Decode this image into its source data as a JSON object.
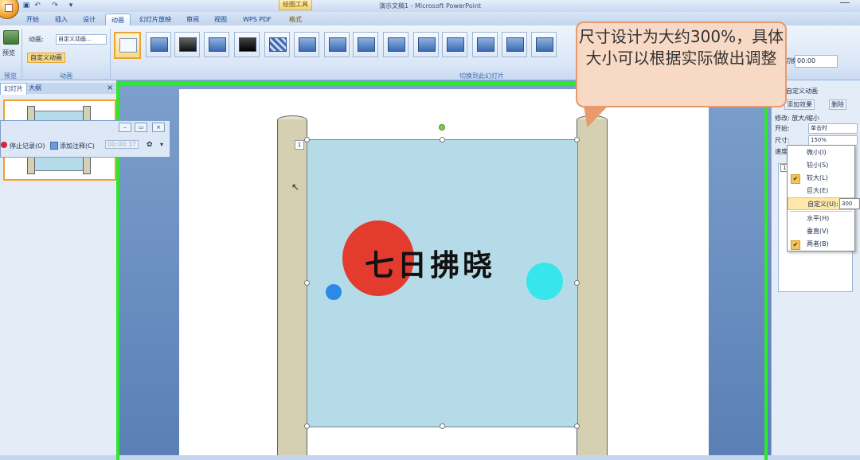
{
  "window": {
    "title": "演示文稿1 - Microsoft PowerPoint",
    "contextual_tab": "绘图工具"
  },
  "tabs": [
    "开始",
    "插入",
    "设计",
    "动画",
    "幻灯片放映",
    "审阅",
    "视图",
    "WPS PDF",
    "格式"
  ],
  "active_tab": "动画",
  "ribbon": {
    "preview_label": "预览",
    "preview_group": "预览",
    "animation_label": "动画:",
    "animation_select": "自定义动画...",
    "custom_animation_button": "自定义动画",
    "animation_group": "动画",
    "transition_group": "切换到此幻灯片",
    "speed_label": "切换效果:",
    "speed_value": "00:00"
  },
  "left_pane": {
    "tabs": [
      "幻灯片",
      "大纲"
    ],
    "stop_record": "停止记录(O)",
    "add_note": "添加注释(C)",
    "timer": "00:00:37"
  },
  "slide": {
    "title": "七日拂晓",
    "order_tag": "1"
  },
  "callout": {
    "text": "尺寸设计为大约300%，具体大小可以根据实际做出调整"
  },
  "task_pane": {
    "header": "自定义动画",
    "add_effect": "添加效果",
    "remove_button": "删除",
    "modify_label": "修改: 放大/缩小",
    "start_label": "开始:",
    "start_value": "单击时",
    "size_label": "尺寸:",
    "size_value": "150%",
    "speed_label": "速度:",
    "list_index": "1"
  },
  "size_dropdown": {
    "items": [
      "微小(I)",
      "较小(S)",
      "较大(L)",
      "巨大(E)",
      "自定义(U):",
      "水平(H)",
      "垂直(V)",
      "两者(B)"
    ],
    "custom_value": "300"
  }
}
